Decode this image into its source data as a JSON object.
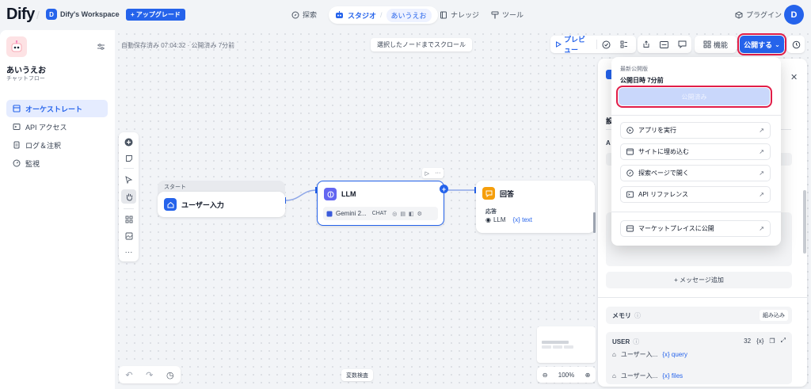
{
  "topbar": {
    "logo": "Dify",
    "workspace_initial": "D",
    "workspace_name": "Dify's Workspace",
    "upgrade_label": "+ アップグレード",
    "nav_explore": "探索",
    "nav_studio": "スタジオ",
    "nav_studio_app": "あいうえお",
    "nav_knowledge": "ナレッジ",
    "nav_tools": "ツール",
    "plugins": "プラグイン",
    "user_initial": "D"
  },
  "sidebar": {
    "app_name": "あいうえお",
    "app_type": "チャットフロー",
    "items": [
      {
        "label": "オーケストレート",
        "icon": "layout-icon",
        "active": true
      },
      {
        "label": "API アクセス",
        "icon": "terminal-icon",
        "active": false
      },
      {
        "label": "ログ＆注釈",
        "icon": "document-icon",
        "active": false
      },
      {
        "label": "監視",
        "icon": "gauge-icon",
        "active": false
      }
    ]
  },
  "canvas": {
    "autosave_status": "自動保存済み 07:04:32 · 公開済み 7分前",
    "scroll_to_selected": "選択したノードまでスクロール",
    "variable_check": "変数検査",
    "zoom": "100%"
  },
  "toolbar": {
    "preview_label": "プレビュー",
    "features_label": "機能",
    "publish_label": "公開する"
  },
  "nodes": {
    "start": {
      "header": "スタート",
      "title": "ユーザー入力"
    },
    "llm": {
      "title": "LLM",
      "model": "Gemini 2...",
      "mode": "CHAT"
    },
    "answer": {
      "title": "回答",
      "field_label": "応答",
      "source": "LLM",
      "var": "{x} text"
    }
  },
  "right_panel": {
    "add_message": "+ メッセージ追加",
    "memory_label": "メモリ",
    "memory_button": "組み込み",
    "user_label": "USER",
    "user_count": "32",
    "user_var_icon": "{x}",
    "var_rows": [
      {
        "source": "ユーザー入...",
        "var": "{x} query"
      },
      {
        "source": "ユーザー入...",
        "var": "{x} files"
      }
    ]
  },
  "publish_dropdown": {
    "latest_label": "最新公開版",
    "published_time": "公開日時 7分前",
    "published_button": "公開済み",
    "items": [
      {
        "label": "アプリを実行",
        "icon": "play-circle-icon"
      },
      {
        "label": "サイトに埋め込む",
        "icon": "embed-icon"
      },
      {
        "label": "探索ページで開く",
        "icon": "explore-icon"
      },
      {
        "label": "API リファレンス",
        "icon": "terminal-icon"
      }
    ],
    "marketplace_label": "マーケットプレイスに公開"
  },
  "colors": {
    "accent": "#2563eb",
    "highlight": "#e11d48",
    "published_button_bg": "#c9d7fb"
  }
}
